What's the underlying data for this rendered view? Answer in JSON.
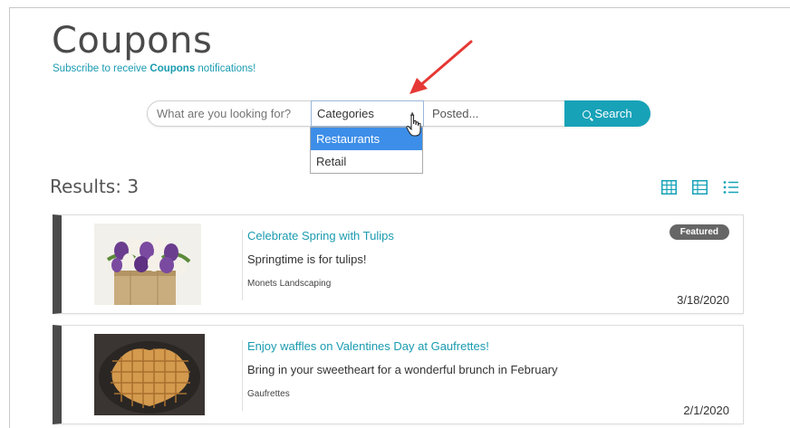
{
  "page": {
    "title": "Coupons",
    "subscribe_prefix": "Subscribe to receive ",
    "subscribe_bold": "Coupons",
    "subscribe_suffix": " notifications!"
  },
  "search": {
    "placeholder": "What are you looking for?",
    "category_label": "Categories",
    "posted_placeholder": "Posted...",
    "button_label": "Search",
    "category_options": [
      "Restaurants",
      "Retail"
    ],
    "highlighted_option": "Restaurants"
  },
  "results": {
    "label": "Results: 3"
  },
  "colors": {
    "accent": "#17a2b8",
    "link": "#1a9bb0",
    "selected_option": "#3d8ee8",
    "annotation_arrow": "#e53935",
    "card_stripe": "#4a4a4a"
  },
  "view_icons": [
    "grid-view-icon",
    "table-view-icon",
    "list-view-icon"
  ],
  "coupons": [
    {
      "title": "Celebrate Spring with Tulips",
      "description": "Springtime is for tulips!",
      "company": "Monets Landscaping",
      "date": "3/18/2020",
      "badge": "Featured",
      "image": "tulips-image"
    },
    {
      "title": "Enjoy waffles on Valentines Day at Gaufrettes!",
      "description": "Bring in your sweetheart for a wonderful brunch in February",
      "company": "Gaufrettes",
      "date": "2/1/2020",
      "image": "waffle-image"
    }
  ]
}
